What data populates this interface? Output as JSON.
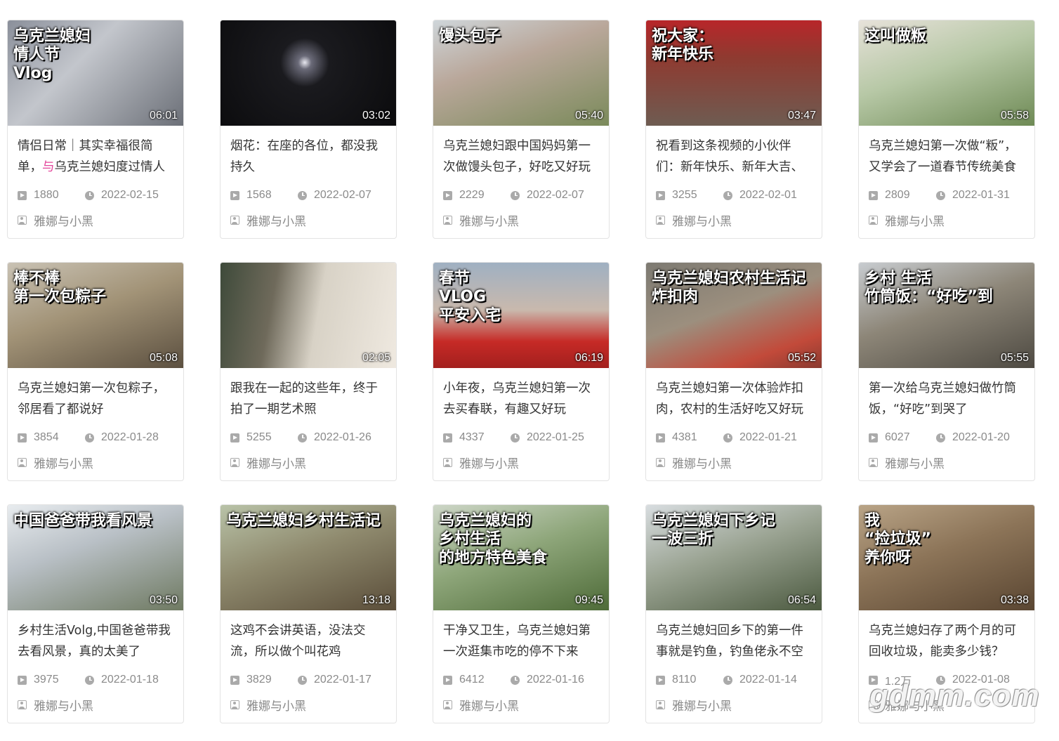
{
  "videos": [
    {
      "title": "情侣日常｜其实幸福很简单，与乌克兰媳妇度过情人",
      "title_pre": "情侣日常｜其实幸福很简单，",
      "title_hl": "与",
      "title_post": "乌克兰媳妇度过情人",
      "views": "1880",
      "date": "2022-02-15",
      "author": "雅娜与小黑",
      "duration": "06:01",
      "caption": "乌克兰媳妇\n情人节\nVlog",
      "bg": "linear-gradient(135deg,#8a8f9a 0%,#c3c6cc 40%,#6c7078 100%)"
    },
    {
      "title": "烟花：在座的各位，都没我持久",
      "views": "1568",
      "date": "2022-02-07",
      "author": "雅娜与小黑",
      "duration": "03:02",
      "caption": "",
      "bg": "radial-gradient(circle at 48% 40%,#e8e8f0 0%,#6a6a78 6%,#1a1a1e 22%,#0b0b0d 100%)"
    },
    {
      "title": "乌克兰媳妇跟中国妈妈第一次做馒头包子，好吃又好玩",
      "views": "2229",
      "date": "2022-02-07",
      "author": "雅娜与小黑",
      "duration": "05:40",
      "caption": "馒头包子",
      "bg": "linear-gradient(160deg,#cfd6da 0%,#b9a79a 40%,#7a8a5a 100%)"
    },
    {
      "title": "祝看到这条视频的小伙伴们：新年快乐、新年大吉、",
      "views": "3255",
      "date": "2022-02-01",
      "author": "雅娜与小黑",
      "duration": "03:47",
      "caption": "祝大家：\n新年快乐",
      "bg": "linear-gradient(180deg,#b8262a 0%,#8f3a30 35%,#6e5c52 100%)"
    },
    {
      "title": "乌克兰媳妇第一次做“粄”，又学会了一道春节传统美食",
      "views": "2809",
      "date": "2022-01-31",
      "author": "雅娜与小黑",
      "duration": "05:58",
      "caption": "这叫做粄",
      "bg": "linear-gradient(160deg,#e7e2da 0%,#b7c8a6 45%,#6e8a55 100%)"
    },
    {
      "title": "乌克兰媳妇第一次包粽子，邻居看了都说好",
      "views": "3854",
      "date": "2022-01-28",
      "author": "雅娜与小黑",
      "duration": "05:08",
      "caption": "棒不棒\n第一次包粽子",
      "bg": "linear-gradient(160deg,#c9c2b4 0%,#a29377 45%,#5c5040 100%)"
    },
    {
      "title": "跟我在一起的这些年，终于拍了一期艺术照",
      "views": "5255",
      "date": "2022-01-26",
      "author": "雅娜与小黑",
      "duration": "02:05",
      "caption": "",
      "bg": "linear-gradient(100deg,#3e4a3a 0%,#6f6a5b 30%,#d8d2c6 55%,#efe9e0 100%)"
    },
    {
      "title": "小年夜，乌克兰媳妇第一次去买春联，有趣又好玩",
      "views": "4337",
      "date": "2022-01-25",
      "author": "雅娜与小黑",
      "duration": "06:19",
      "caption": "春节\nVLOG\n平安入宅",
      "bg": "linear-gradient(180deg,#9fb0c2 0%,#c9b9ad 45%,#c62a26 75%,#a3201e 100%)"
    },
    {
      "title": "乌克兰媳妇第一次体验炸扣肉，农村的生活好吃又好玩",
      "views": "4381",
      "date": "2022-01-21",
      "author": "雅娜与小黑",
      "duration": "05:52",
      "caption": "乌克兰媳妇农村生活记\n炸扣肉",
      "bg": "linear-gradient(160deg,#7d7a72 0%,#9c8f7e 45%,#c24a3a 80%,#8a3a30 100%)"
    },
    {
      "title": "第一次给乌克兰媳妇做竹筒饭，“好吃”到哭了",
      "views": "6027",
      "date": "2022-01-20",
      "author": "雅娜与小黑",
      "duration": "05:55",
      "caption": "乡村  生活\n竹筒饭：“好吃”到",
      "bg": "linear-gradient(160deg,#c8ccd0 0%,#8d8678 45%,#4e4a42 100%)"
    },
    {
      "title": "乡村生活Volg,中国爸爸带我去看风景，真的太美了",
      "views": "3975",
      "date": "2022-01-18",
      "author": "雅娜与小黑",
      "duration": "03:50",
      "caption": "中国爸爸带我看风景",
      "bg": "linear-gradient(160deg,#e8ecef 0%,#b9c0c6 40%,#6f7a62 100%)"
    },
    {
      "title": "这鸡不会讲英语，没法交流，所以做个叫花鸡",
      "views": "3829",
      "date": "2022-01-17",
      "author": "雅娜与小黑",
      "duration": "13:18",
      "caption": "乌克兰媳妇乡村生活记",
      "bg": "linear-gradient(160deg,#b9c3a8 0%,#8f8a6e 45%,#5b4e3a 100%)"
    },
    {
      "title": "干净又卫生，乌克兰媳妇第一次逛集市吃的停不下来",
      "views": "6412",
      "date": "2022-01-16",
      "author": "雅娜与小黑",
      "duration": "09:45",
      "caption": "乌克兰媳妇的\n乡村生活\n的地方特色美食",
      "bg": "linear-gradient(160deg,#cdd6c7 0%,#8ea67a 45%,#4e6b38 100%)"
    },
    {
      "title": "乌克兰媳妇回乡下的第一件事就是钓鱼，钓鱼佬永不空",
      "views": "8110",
      "date": "2022-01-14",
      "author": "雅娜与小黑",
      "duration": "06:54",
      "caption": "乌克兰媳妇下乡记\n一波三折",
      "bg": "linear-gradient(160deg,#d8dde0 0%,#9aa392 45%,#4c5a40 100%)"
    },
    {
      "title": "乌克兰媳妇存了两个月的可回收垃圾，能卖多少钱？",
      "views": "1.2万",
      "date": "2022-01-08",
      "author": "雅娜与小黑",
      "duration": "03:38",
      "caption": "我\n“捡垃圾”\n养你呀",
      "bg": "linear-gradient(160deg,#b9a487 0%,#8c7458 45%,#5a4632 100%)"
    }
  ],
  "watermark": "gdmm.com",
  "icons": {
    "views": "play-count-icon",
    "date": "clock-icon",
    "author": "user-icon"
  }
}
